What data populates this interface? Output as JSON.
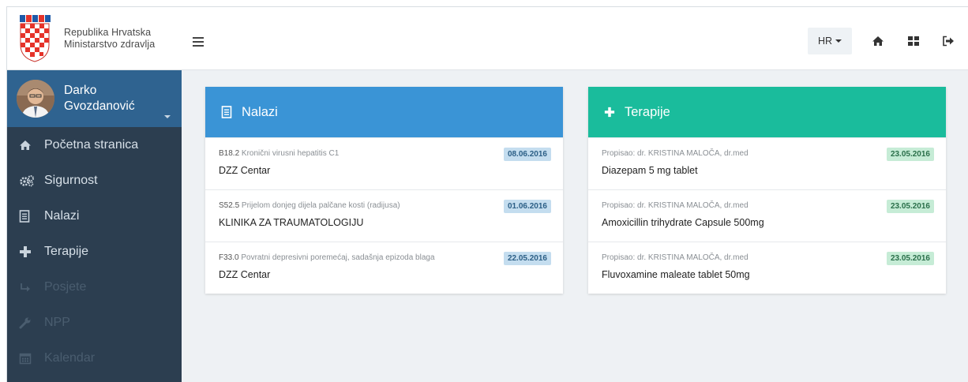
{
  "brand": {
    "line1": "Republika Hrvatska",
    "line2": "Ministarstvo zdravlja"
  },
  "user": {
    "first_name": "Darko",
    "last_name": "Gvozdanović"
  },
  "sidebar": {
    "items": [
      {
        "label": "Početna stranica",
        "icon": "home-icon",
        "state": "active"
      },
      {
        "label": "Sigurnost",
        "icon": "gears-icon",
        "state": "active"
      },
      {
        "label": "Nalazi",
        "icon": "document-icon",
        "state": "active"
      },
      {
        "label": "Terapije",
        "icon": "plus-icon",
        "state": "active"
      },
      {
        "label": "Posjete",
        "icon": "arrow-right-icon",
        "state": "disabled"
      },
      {
        "label": "NPP",
        "icon": "wrench-icon",
        "state": "disabled"
      },
      {
        "label": "Kalendar",
        "icon": "calendar-icon",
        "state": "disabled"
      }
    ]
  },
  "topbar": {
    "language": "HR"
  },
  "colors": {
    "sidebar": "#2c3e50",
    "profile": "#2f6390",
    "nalazi": "#3a94d6",
    "terapije": "#1abc9c"
  },
  "nalazi": {
    "title": "Nalazi",
    "items": [
      {
        "code": "B18.2",
        "description": "Kronični virusni hepatitis C1",
        "date": "08.06.2016",
        "location": "DZZ Centar"
      },
      {
        "code": "S52.5",
        "description": "Prijelom donjeg dijela palčane kosti (radijusa)",
        "date": "01.06.2016",
        "location": "KLINIKA ZA TRAUMATOLOGIJU"
      },
      {
        "code": "F33.0",
        "description": "Povratni depresivni poremećaj, sadašnja epizoda blaga",
        "date": "22.05.2016",
        "location": "DZZ Centar"
      }
    ]
  },
  "terapije": {
    "title": "Terapije",
    "items": [
      {
        "prescriber": "Propisao: dr. KRISTINA MALOČA, dr.med",
        "date": "23.05.2016",
        "drug": "Diazepam 5 mg tablet"
      },
      {
        "prescriber": "Propisao: dr. KRISTINA MALOČA, dr.med",
        "date": "23.05.2016",
        "drug": "Amoxicillin trihydrate Capsule 500mg"
      },
      {
        "prescriber": "Propisao: dr. KRISTINA MALOČA, dr.med",
        "date": "23.05.2016",
        "drug": "Fluvoxamine maleate tablet 50mg"
      }
    ]
  }
}
